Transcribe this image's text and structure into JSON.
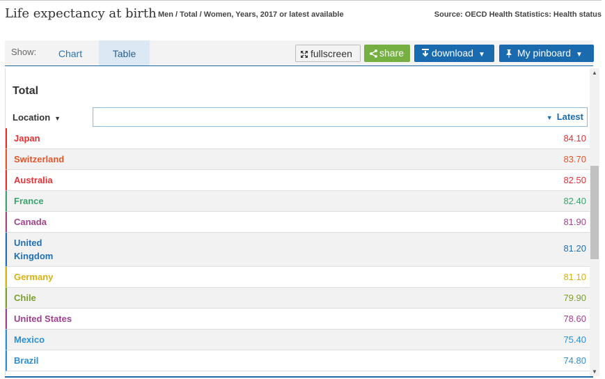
{
  "header": {
    "title": "Life expectancy at birth",
    "subtitle": "Men / Total / Women, Years, 2017 or latest available",
    "source": "Source: OECD Health Statistics: Health status"
  },
  "toolbar": {
    "show_label": "Show:",
    "tabs": [
      {
        "label": "Chart",
        "active": false
      },
      {
        "label": "Table",
        "active": true
      }
    ],
    "fullscreen_label": "fullscreen",
    "share_label": "share",
    "download_label": "download",
    "pinboard_label": "My pinboard"
  },
  "table": {
    "title": "Total",
    "location_header": "Location",
    "latest_header": "Latest",
    "rows": [
      {
        "location": "Japan",
        "value": "84.10",
        "color": "#e03131"
      },
      {
        "location": "Switzerland",
        "value": "83.70",
        "color": "#e0562a"
      },
      {
        "location": "Australia",
        "value": "82.50",
        "color": "#e03137"
      },
      {
        "location": "France",
        "value": "82.40",
        "color": "#3ba36b"
      },
      {
        "location": "Canada",
        "value": "81.90",
        "color": "#a2448b"
      },
      {
        "location": "United Kingdom",
        "value": "81.20",
        "color": "#1f6fb5"
      },
      {
        "location": "Germany",
        "value": "81.10",
        "color": "#d4b20f"
      },
      {
        "location": "Chile",
        "value": "79.90",
        "color": "#7aa02c"
      },
      {
        "location": "United States",
        "value": "78.60",
        "color": "#9d3f8d"
      },
      {
        "location": "Mexico",
        "value": "75.40",
        "color": "#2c8fd6"
      },
      {
        "location": "Brazil",
        "value": "74.80",
        "color": "#2c8fd6"
      }
    ]
  }
}
